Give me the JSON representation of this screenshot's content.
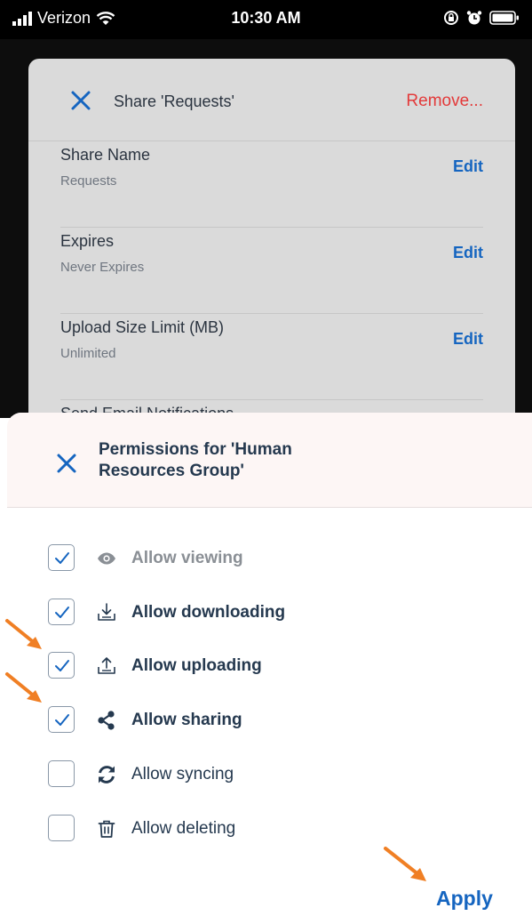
{
  "status_bar": {
    "carrier": "Verizon",
    "time": "10:30 AM",
    "icons": [
      "signal-icon",
      "wifi-icon",
      "rotation-lock-icon",
      "alarm-icon",
      "battery-icon"
    ]
  },
  "share_dialog": {
    "title": "Share 'Requests'",
    "remove_label": "Remove...",
    "rows": [
      {
        "title": "Share Name",
        "value": "Requests",
        "action": "Edit"
      },
      {
        "title": "Expires",
        "value": "Never Expires",
        "action": "Edit"
      },
      {
        "title": "Upload Size Limit (MB)",
        "value": "Unlimited",
        "action": "Edit"
      },
      {
        "title": "Send Email Notifications"
      }
    ]
  },
  "permissions_sheet": {
    "title": "Permissions for 'Human Resources Group'",
    "items": [
      {
        "label": "Allow viewing",
        "checked": true,
        "icon": "eye-icon"
      },
      {
        "label": "Allow downloading",
        "checked": true,
        "icon": "download-icon"
      },
      {
        "label": "Allow uploading",
        "checked": true,
        "icon": "upload-icon"
      },
      {
        "label": "Allow sharing",
        "checked": true,
        "icon": "share-icon"
      },
      {
        "label": "Allow syncing",
        "checked": false,
        "icon": "sync-icon"
      },
      {
        "label": "Allow deleting",
        "checked": false,
        "icon": "trash-icon"
      }
    ],
    "apply_label": "Apply"
  },
  "colors": {
    "accent": "#1565c0",
    "danger": "#e33a3a",
    "annotation_arrow": "#f07f24",
    "text_dark": "#25394f"
  }
}
